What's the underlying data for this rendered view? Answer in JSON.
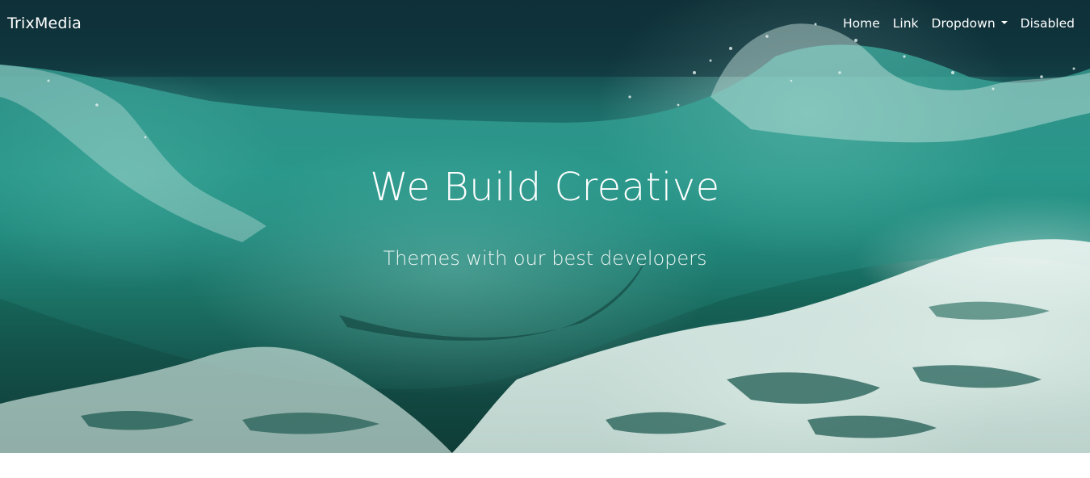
{
  "navbar": {
    "brand": "TrixMedia",
    "items": [
      {
        "label": "Home"
      },
      {
        "label": "Link"
      },
      {
        "label": "Dropdown"
      },
      {
        "label": "Disabled"
      }
    ]
  },
  "hero": {
    "title": "We Build Creative",
    "subtitle": "Themes with our best developers",
    "background": "ocean-wave-photo"
  },
  "colors": {
    "nav_text": "#ffffff",
    "hero_text": "#ffffff",
    "page_background": "#ffffff"
  }
}
